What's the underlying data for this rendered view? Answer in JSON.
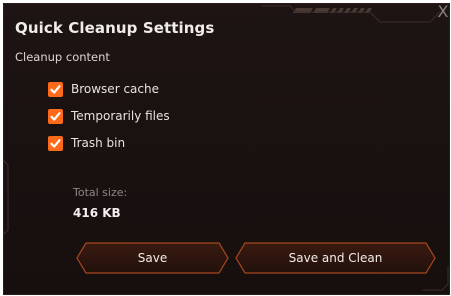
{
  "dialog": {
    "title": "Quick Cleanup Settings",
    "close_glyph": "X",
    "section_label": "Cleanup content",
    "items": [
      {
        "label": "Browser cache",
        "checked": true
      },
      {
        "label": "Temporarily files",
        "checked": true
      },
      {
        "label": "Trash bin",
        "checked": true
      }
    ],
    "total_size_label": "Total size:",
    "total_size_value": "416 KB",
    "buttons": {
      "save": "Save",
      "save_and_clean": "Save and Clean"
    }
  },
  "colors": {
    "background": "#1a1312",
    "accent": "#ff6a1a",
    "button_border": "#a9471f",
    "text": "#f0ecea",
    "muted_text": "#8f8684"
  },
  "icons": {
    "close": "close-icon",
    "check": "checkmark-icon"
  }
}
